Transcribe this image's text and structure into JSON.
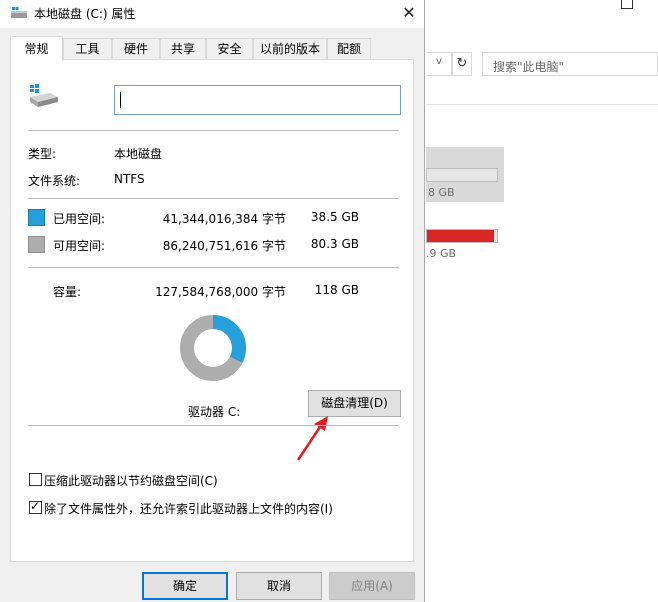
{
  "background": {
    "search_placeholder": "搜索\"此电脑\"",
    "refresh_glyph": "↻",
    "dropdown_glyph": "v",
    "drive1_text": "8 GB",
    "drive2_text": ".9 GB",
    "drive2_usage_fraction": 0.95,
    "drive2_bar_color": "#da2626"
  },
  "dialog": {
    "title": "本地磁盘 (C:) 属性",
    "close_glyph": "✕",
    "tabs": [
      {
        "label": "常规",
        "active": true
      },
      {
        "label": "工具",
        "active": false
      },
      {
        "label": "硬件",
        "active": false
      },
      {
        "label": "共享",
        "active": false
      },
      {
        "label": "安全",
        "active": false
      },
      {
        "label": "以前的版本",
        "active": false
      },
      {
        "label": "配额",
        "active": false
      }
    ],
    "drive_name_value": "",
    "type_label": "类型:",
    "type_value": "本地磁盘",
    "fs_label": "文件系统:",
    "fs_value": "NTFS",
    "used": {
      "label": "已用空间:",
      "bytes": "41,344,016,384 字节",
      "size": "38.5 GB",
      "color": "#26a0da"
    },
    "free": {
      "label": "可用空间:",
      "bytes": "86,240,751,616 字节",
      "size": "80.3 GB",
      "color": "#adadad"
    },
    "capacity": {
      "label": "容量:",
      "bytes": "127,584,768,000 字节",
      "size": "118 GB"
    },
    "used_fraction": 0.324,
    "drive_label": "驱动器 C:",
    "cleanup_button": "磁盘清理(D)",
    "compress_label": "压缩此驱动器以节约磁盘空间(C)",
    "compress_checked": false,
    "index_label": "除了文件属性外，还允许索引此驱动器上文件的内容(I)",
    "index_checked": true,
    "checkmark_glyph": "✓",
    "ok_button": "确定",
    "cancel_button": "取消",
    "apply_button": "应用(A)"
  }
}
